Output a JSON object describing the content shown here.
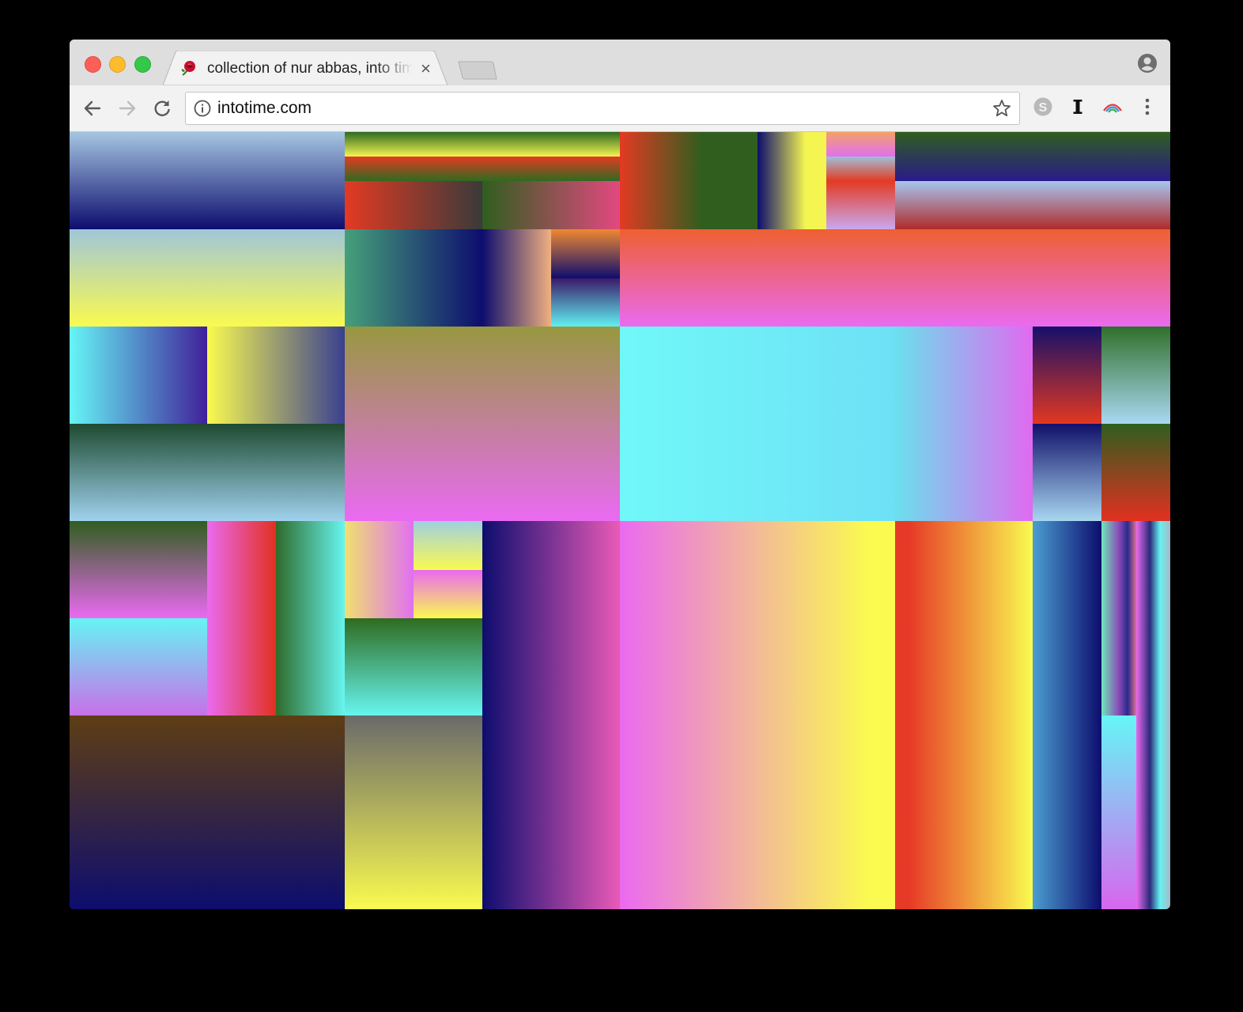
{
  "browser": {
    "tab": {
      "title": "collection of nur abbas, into time",
      "favicon": "rose-icon",
      "close": "×"
    },
    "address": {
      "url": "intotime.com",
      "info_icon": "info-icon"
    },
    "extensions": [
      "skype-icon",
      "instapaper-icon",
      "rainbow-arc-icon"
    ],
    "menu_icon": "vertical-dots-icon",
    "profile_icon": "profile-icon"
  }
}
